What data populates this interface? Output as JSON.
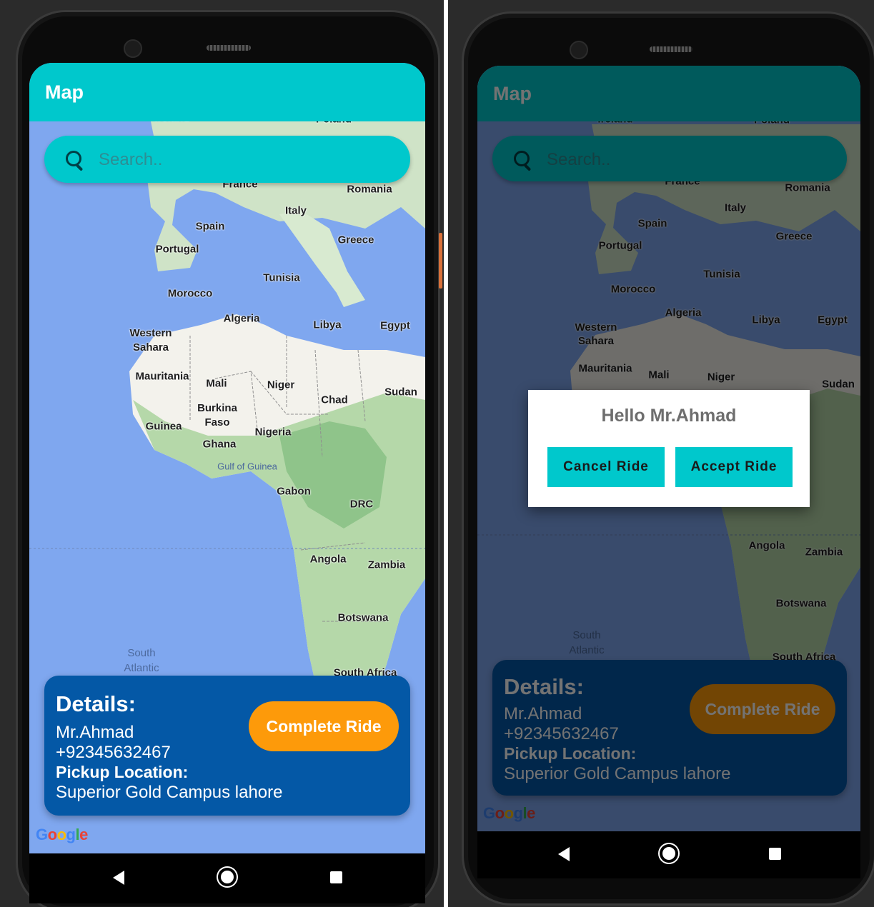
{
  "app": {
    "title": "Map"
  },
  "search": {
    "placeholder": "Search.."
  },
  "map": {
    "labels": {
      "ireland": "Ireland",
      "poland": "Poland",
      "france": "France",
      "romania": "Romania",
      "italy": "Italy",
      "spain": "Spain",
      "portugal": "Portugal",
      "greece": "Greece",
      "tunisia": "Tunisia",
      "morocco": "Morocco",
      "algeria": "Algeria",
      "libya": "Libya",
      "egypt": "Egypt",
      "western_sahara": "Western Sahara",
      "mauritania": "Mauritania",
      "mali": "Mali",
      "niger": "Niger",
      "chad": "Chad",
      "sudan": "Sudan",
      "burkina_faso": "Burkina Faso",
      "guinea": "Guinea",
      "nigeria": "Nigeria",
      "ghana": "Ghana",
      "gulf_of_guinea": "Gulf of Guinea",
      "gabon": "Gabon",
      "drc": "DRC",
      "angola": "Angola",
      "zambia": "Zambia",
      "botswana": "Botswana",
      "south_atlantic": "South Atlantic Ocean",
      "south_africa": "South Africa"
    },
    "attribution": [
      "G",
      "o",
      "o",
      "g",
      "l",
      "e"
    ]
  },
  "details": {
    "title": "Details:",
    "name": "Mr.Ahmad",
    "phone": "+92345632467",
    "pickup_label": "Pickup Location:",
    "pickup_value": "Superior Gold Campus lahore"
  },
  "complete_button": "Complete Ride",
  "dialog": {
    "title": "Hello Mr.Ahmad",
    "cancel_label": "Cancel Ride",
    "accept_label": "Accept Ride"
  },
  "colors": {
    "app_bar": "#00c8cc",
    "details_card": "#0458a6",
    "complete_button": "#fd9a0a",
    "ocean": "#7fa7ef"
  },
  "icons": {
    "search": "search-icon",
    "back": "nav-back-icon",
    "home": "nav-home-icon",
    "recents": "nav-recents-icon"
  }
}
